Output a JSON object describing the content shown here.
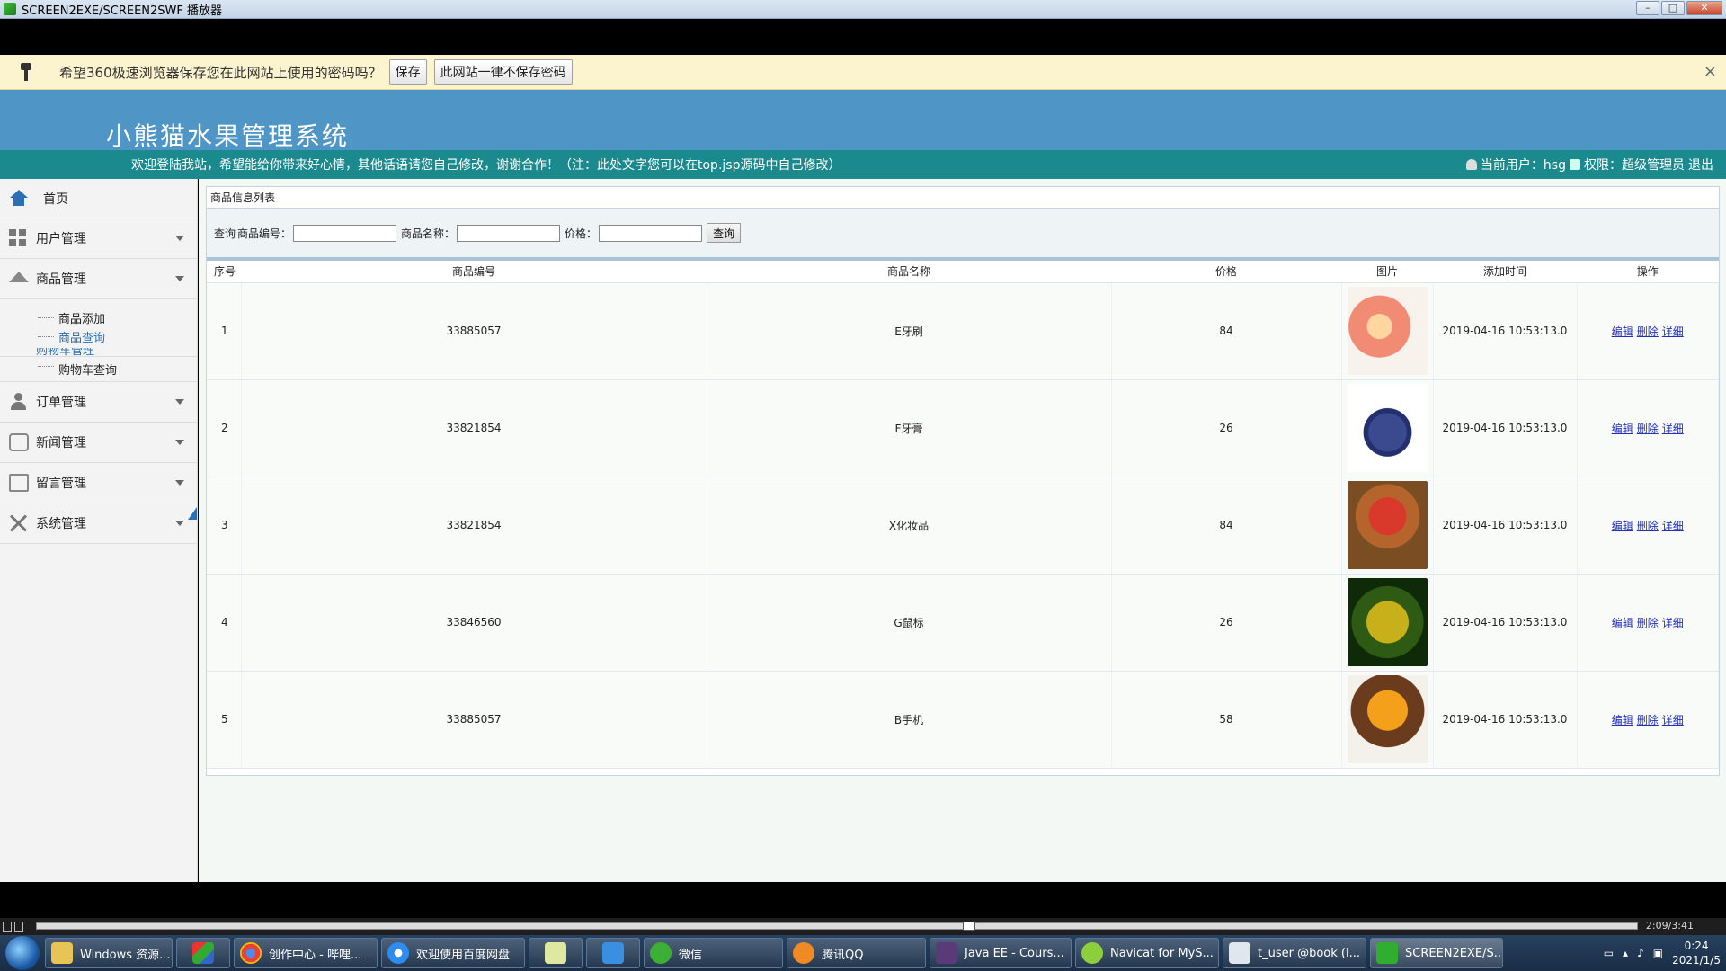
{
  "player": {
    "title": "SCREEN2EXE/SCREEN2SWF 播放器",
    "controls": {
      "minimize": "–",
      "maximize": "□",
      "close": "✕"
    },
    "time": "2:09/3:41"
  },
  "password_bar": {
    "message": "希望360极速浏览器保存您在此网站上使用的密码吗？",
    "save_label": "保存",
    "never_label": "此网站一律不保存密码",
    "close": "×"
  },
  "site": {
    "title": "小熊猫水果管理系统",
    "welcome": "欢迎登陆我站，希望能给你带来好心情，其他话语请您自己修改，谢谢合作！（注：此处文字您可以在top.jsp源码中自己修改）",
    "current_user": "当前用户：hsg",
    "role": "权限：超级管理员",
    "logout": "退出"
  },
  "sidebar": {
    "home": "首页",
    "items": [
      {
        "label": "用户管理"
      },
      {
        "label": "商品管理"
      }
    ],
    "goods_sub": [
      "商品添加",
      "商品查询"
    ],
    "cart_label_partial": "购物车管理",
    "cart_sub": "购物车查询",
    "bottom_items": [
      {
        "label": "订单管理"
      },
      {
        "label": "新闻管理"
      },
      {
        "label": "留言管理"
      },
      {
        "label": "系统管理"
      }
    ]
  },
  "content": {
    "panel_title": "商品信息列表",
    "search": {
      "label": "查询",
      "code_label": "商品编号：",
      "name_label": "商品名称：",
      "price_label": "价格：",
      "button": "查询"
    },
    "columns": [
      "序号",
      "商品编号",
      "商品名称",
      "价格",
      "图片",
      "添加时间",
      "操作"
    ],
    "actions": {
      "edit": "编辑",
      "delete": "删除",
      "detail": "详细"
    },
    "rows": [
      {
        "index": "1",
        "code": "33885057",
        "name": "E牙刷",
        "price": "84",
        "time": "2019-04-16 10:53:13.0"
      },
      {
        "index": "2",
        "code": "33821854",
        "name": "F牙膏",
        "price": "26",
        "time": "2019-04-16 10:53:13.0"
      },
      {
        "index": "3",
        "code": "33821854",
        "name": "X化妆品",
        "price": "84",
        "time": "2019-04-16 10:53:13.0"
      },
      {
        "index": "4",
        "code": "33846560",
        "name": "G鼠标",
        "price": "26",
        "time": "2019-04-16 10:53:13.0"
      },
      {
        "index": "5",
        "code": "33885057",
        "name": "B手机",
        "price": "58",
        "time": "2019-04-16 10:53:13.0"
      }
    ]
  },
  "taskbar": {
    "items": [
      "Windows 资源...",
      "创作中心 - 哔哩...",
      "欢迎使用百度网盘",
      "微信",
      "腾讯QQ",
      "Java EE - Cours...",
      "Navicat for MyS...",
      "t_user @book (l...",
      "SCREEN2EXE/S..."
    ],
    "time": "0:24",
    "date": "2021/1/5"
  },
  "colors": {
    "header": "#4f96c6",
    "welcome_bar": "#1b8a8f",
    "link": "#2331b8"
  }
}
